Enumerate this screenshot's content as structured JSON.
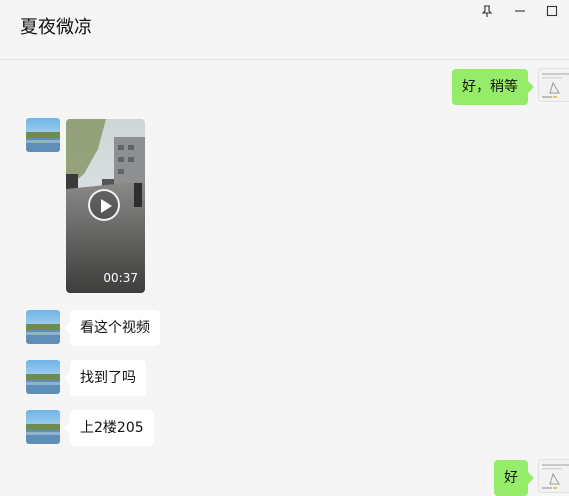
{
  "header": {
    "title": "夏夜微凉"
  },
  "window_controls": {
    "pin_icon": "pin-icon",
    "minimize_icon": "minimize-icon",
    "maximize_icon": "maximize-icon"
  },
  "messages": [
    {
      "sender": "self",
      "type": "text",
      "text": "好，稍等"
    },
    {
      "sender": "contact",
      "type": "video",
      "duration": "00:37"
    },
    {
      "sender": "contact",
      "type": "text",
      "text": "看这个视频"
    },
    {
      "sender": "contact",
      "type": "text",
      "text": "找到了吗"
    },
    {
      "sender": "contact",
      "type": "text",
      "text": "上2楼205"
    },
    {
      "sender": "self",
      "type": "text",
      "text": "好"
    }
  ],
  "colors": {
    "background": "#f5f5f5",
    "outgoing_bubble": "#95ec69",
    "incoming_bubble": "#ffffff",
    "divider": "#e4e4e4"
  }
}
